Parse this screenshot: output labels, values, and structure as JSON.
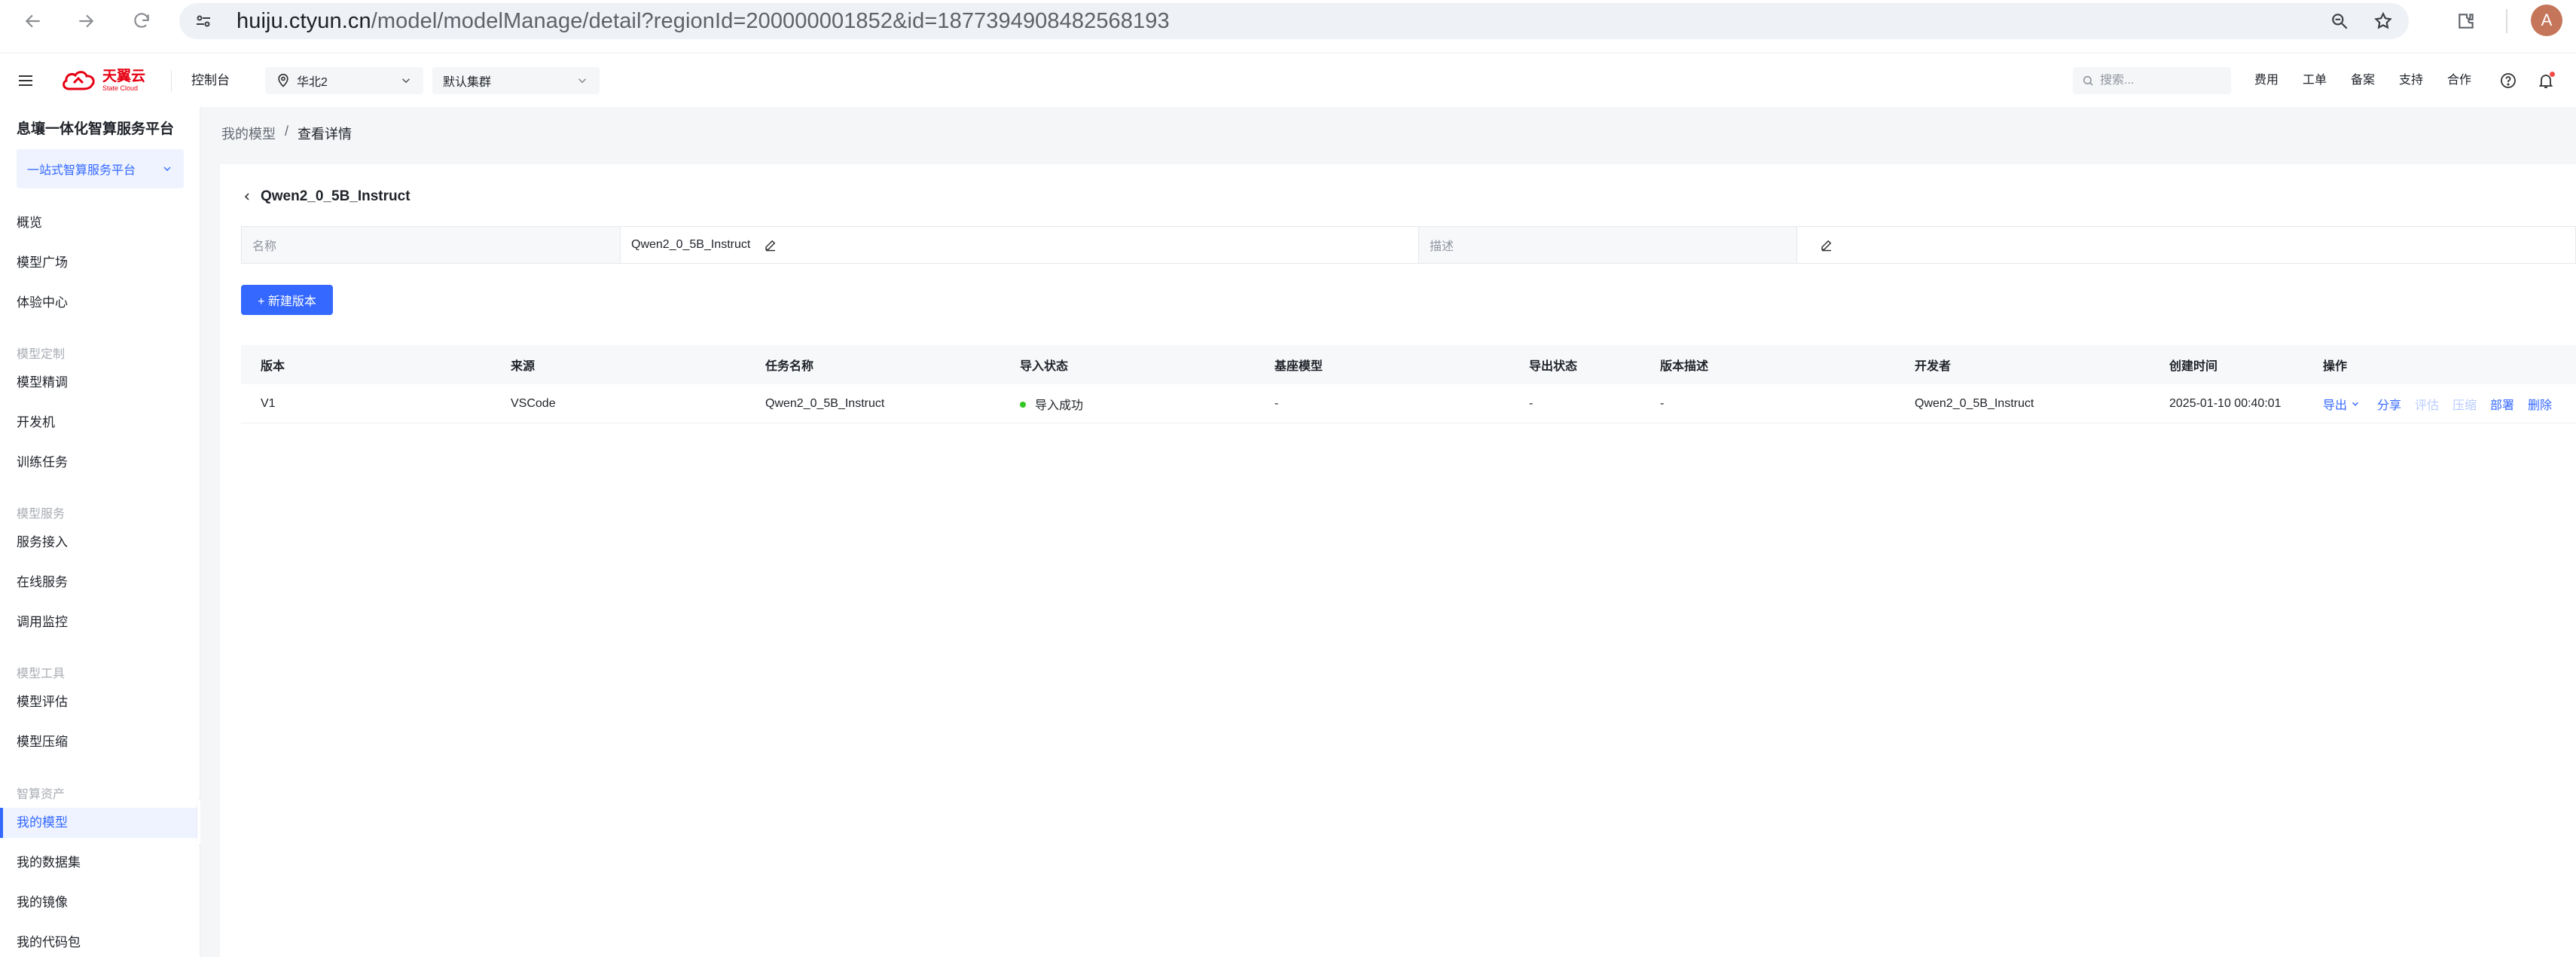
{
  "browser": {
    "url_host": "huiju.ctyun.cn",
    "url_path": "/model/modelManage/detail?regionId=200000001852&id=1877394908482568193",
    "profile_initial": "A"
  },
  "header": {
    "logo_cn": "天翼云",
    "logo_en": "State Cloud",
    "console": "控制台",
    "region": "华北2",
    "cluster": "默认集群",
    "search_placeholder": "搜索...",
    "links": [
      "费用",
      "工单",
      "备案",
      "支持",
      "合作"
    ]
  },
  "sidebar": {
    "title": "息壤一体化智算服务平台",
    "platform": "一站式智算服务平台",
    "items_top": [
      "概览",
      "模型广场",
      "体验中心"
    ],
    "group_custom": "模型定制",
    "items_custom": [
      "模型精调",
      "开发机",
      "训练任务"
    ],
    "group_service": "模型服务",
    "items_service": [
      "服务接入",
      "在线服务",
      "调用监控"
    ],
    "group_tools": "模型工具",
    "items_tools": [
      "模型评估",
      "模型压缩"
    ],
    "group_assets": "智算资产",
    "items_assets": [
      "我的模型",
      "我的数据集",
      "我的镜像",
      "我的代码包"
    ]
  },
  "main": {
    "breadcrumb": [
      "我的模型",
      "/",
      "查看详情"
    ],
    "title": "Qwen2_0_5B_Instruct",
    "info": {
      "name_label": "名称",
      "name_value": "Qwen2_0_5B_Instruct",
      "desc_label": "描述",
      "desc_value": ""
    },
    "new_version": "+ 新建版本",
    "table": {
      "columns": [
        "版本",
        "来源",
        "任务名称",
        "导入状态",
        "基座模型",
        "导出状态",
        "版本描述",
        "开发者",
        "创建时间",
        "操作"
      ],
      "rows": [
        {
          "version": "V1",
          "source": "VSCode",
          "task": "Qwen2_0_5B_Instruct",
          "import_status": "导入成功",
          "base_model": "-",
          "export_status": "-",
          "description": "-",
          "developer": "Qwen2_0_5B_Instruct",
          "created": "2025-01-10 00:40:01",
          "ops": [
            "导出",
            "分享",
            "评估",
            "压缩",
            "部署",
            "删除"
          ]
        }
      ]
    }
  },
  "colors": {
    "accent": "#3468ff",
    "success": "#34c724",
    "brand": "#e60012"
  }
}
